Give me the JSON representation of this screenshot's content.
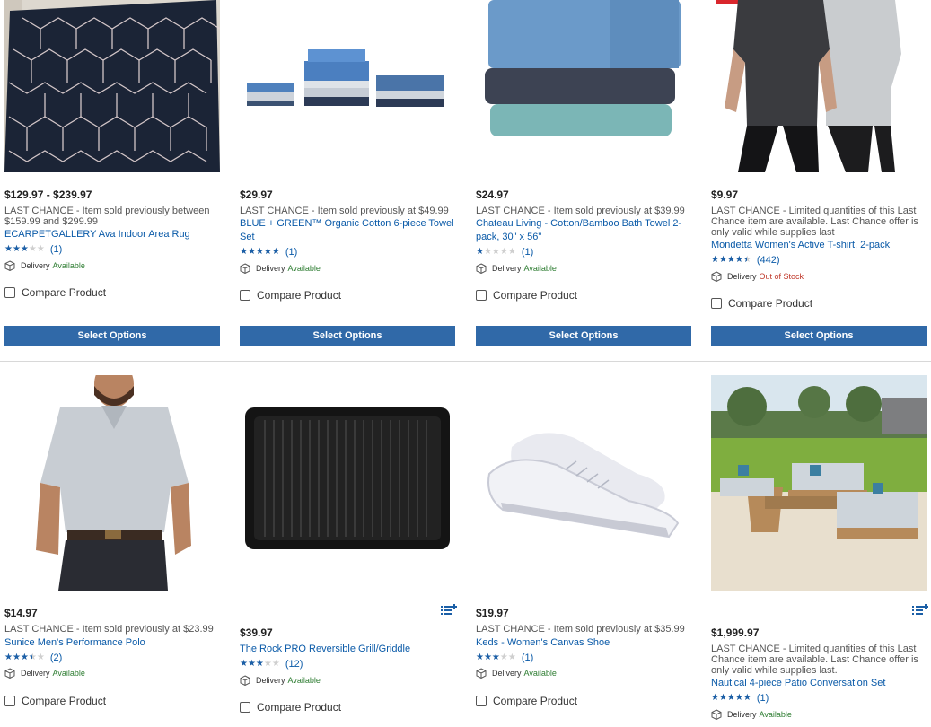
{
  "products": [
    {
      "price": "$129.97 - $239.97",
      "note": "LAST CHANCE - Item sold previously between $159.99 and $299.99",
      "title": "ECARPETGALLERY Ava Indoor Area Rug",
      "rating": 3,
      "reviews": "(1)",
      "delivery_label": "Delivery",
      "availability": "Available",
      "compare": "Compare Product",
      "button": "Select Options"
    },
    {
      "price": "$29.97",
      "note": "LAST CHANCE - Item sold previously at $49.99",
      "title": "BLUE + GREEN™ Organic Cotton 6-piece Towel Set",
      "rating": 5,
      "reviews": "(1)",
      "delivery_label": "Delivery",
      "availability": "Available",
      "compare": "Compare Product",
      "button": "Select Options"
    },
    {
      "price": "$24.97",
      "note": "LAST CHANCE - Item sold previously at $39.99",
      "title": "Chateau Living - Cotton/Bamboo Bath Towel 2-pack, 30\" x 56\"",
      "rating": 1,
      "reviews": "(1)",
      "delivery_label": "Delivery",
      "availability": "Available",
      "compare": "Compare Product",
      "button": "Select Options"
    },
    {
      "price": "$9.97",
      "note": "LAST CHANCE - Limited quantities of this Last Chance item are available. Last Chance offer is only valid while supplies last",
      "title": "Mondetta Women's Active T-shirt, 2-pack",
      "rating": 4.5,
      "reviews": "(442)",
      "delivery_label": "Delivery",
      "availability": "Out of Stock",
      "compare": "Compare Product",
      "button": "Select Options"
    },
    {
      "price": "$14.97",
      "note": "LAST CHANCE - Item sold previously at $23.99",
      "title": "Sunice Men's Performance Polo",
      "rating": 3.5,
      "reviews": "(2)",
      "delivery_label": "Delivery",
      "availability": "Available",
      "compare": "Compare Product"
    },
    {
      "price": "$39.97",
      "note": "",
      "title": "The Rock PRO Reversible Grill/Griddle",
      "rating": 3,
      "reviews": "(12)",
      "delivery_label": "Delivery",
      "availability": "Available",
      "compare": "Compare Product"
    },
    {
      "price": "$19.97",
      "note": "LAST CHANCE - Item sold previously at $35.99",
      "title": "Keds - Women's Canvas Shoe",
      "rating": 3,
      "reviews": "(1)",
      "delivery_label": "Delivery",
      "availability": "Available",
      "compare": "Compare Product"
    },
    {
      "price": "$1,999.97",
      "note": "LAST CHANCE - Limited quantities of this Last Chance item are available. Last Chance offer is only valid while supplies last.",
      "title": "Nautical 4-piece Patio Conversation Set",
      "rating": 5,
      "reviews": "(1)",
      "delivery_label": "Delivery",
      "availability": "Available",
      "compare": "Compare Product"
    }
  ],
  "colors": {
    "link": "#0a5aa8",
    "button": "#3069a8",
    "star": "#1b5fa7",
    "available": "#2e7d32",
    "out_of_stock": "#c0392b"
  },
  "icons": {
    "delivery": "box-icon",
    "list": "add-to-list-icon",
    "rating": "star-icon"
  }
}
